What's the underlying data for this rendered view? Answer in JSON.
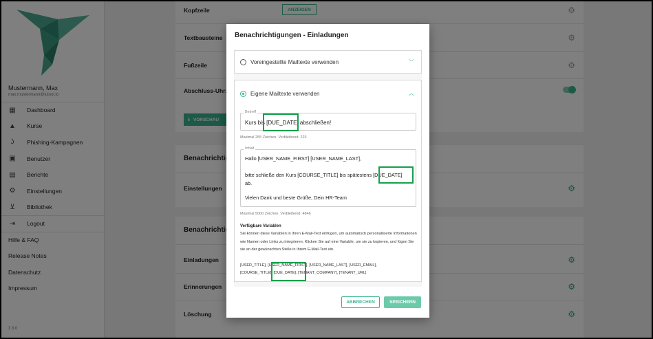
{
  "user": {
    "name": "Mustermann, Max",
    "email": "max.mustermann@lutool.io"
  },
  "nav": [
    {
      "icon": "dashboard-icon",
      "glyph": "▦",
      "label": "Dashboard"
    },
    {
      "icon": "graduation-cap-icon",
      "glyph": "🎓",
      "label": "Kurse"
    },
    {
      "icon": "hook-icon",
      "glyph": "⚓",
      "label": "Phishing-Kampagnen"
    },
    {
      "icon": "person-card-icon",
      "glyph": "▣",
      "label": "Benutzer"
    },
    {
      "icon": "report-icon",
      "glyph": "▤",
      "label": "Berichte"
    },
    {
      "icon": "gear-icon",
      "glyph": "⚙",
      "label": "Einstellungen"
    },
    {
      "icon": "cart-icon",
      "glyph": "🛒",
      "label": "Bibliothek"
    },
    {
      "icon": "logout-icon",
      "glyph": "⇥",
      "label": "Logout"
    }
  ],
  "links": [
    "Hilfe & FAQ",
    "Release Notes",
    "Datenschutz",
    "Impressum"
  ],
  "version": "3.3.0",
  "background": {
    "kopfzeile": "Kopfzeile",
    "anzeigen": "ANZEIGEN",
    "textbausteine": "Textbausteine",
    "fusszeile": "Fußzeile",
    "abschluss": "Abschluss-Uhrze",
    "vorschau": "VORSCHAU",
    "benach1": "Benachrichtig",
    "einstellungen": "Einstellungen",
    "benach2": "Benachrichtig",
    "einladungen": "Einladungen",
    "erinnerungen": "Erinnerungen",
    "loeschung": "Löschung"
  },
  "modal": {
    "title": "Benachrichtigungen - Einladungen",
    "option_preset": "Voreingestellte Mailtexte verwenden",
    "option_custom": "Eigene Mailtexte verwenden",
    "subject_label": "Betreff",
    "subject_value": "Kurs bis [DUE_DATE] abschließen!",
    "subject_hint": "Maximal 255 Zeichen. Verbleibend: 223",
    "content_label": "Inhalt",
    "content_lines": [
      "Hallo [USER_NAME_FIRST] [USER_NAME_LAST],",
      "bitte schließe den Kurs [COURSE_TITLE] bis spätestens [DUE_DATE]",
      "ab.",
      "Vielen Dank und beste Grüße, Dein HR-Team"
    ],
    "content_hint": "Maximal 5000 Zeichen. Verbleibend: 4846",
    "vars_title": "Verfügbare Variablen",
    "vars_desc": "Sie können diese Variablen in Ihren E-Mail-Text einfügen, um automatisch personalisierte Informationen wie Namen oder Links zu integrieren. Klicken Sie auf eine Variable, um sie zu kopieren, und fügen Sie sie an der gewünschten Stelle in Ihrem E-Mail-Text ein.",
    "vars_line1": "[USER_TITLE],   [USER_NAME_FIRST],   [USER_NAME_LAST],   [USER_EMAIL],",
    "vars_line2": "[COURSE_TITLE],   [DUE_DATE],   [TENANT_COMPANY],   [TENANT_URL]",
    "cancel": "ABBRECHEN",
    "save": "SPEICHERN"
  },
  "colors": {
    "accent": "#38b58e",
    "highlight": "#13a04a",
    "logo": "#3e9e86"
  }
}
